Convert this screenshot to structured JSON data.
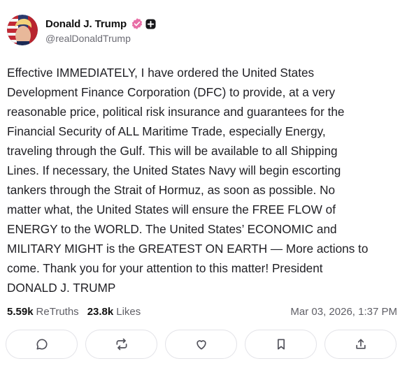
{
  "author": {
    "name": "Donald J. Trump",
    "handle": "@realDonaldTrump",
    "verified_color": "#e86ea6"
  },
  "post": {
    "text": "Effective IMMEDIATELY, I have ordered the United States\nDevelopment Finance Corporation (DFC) to provide, at a very\nreasonable price, political risk insurance and guarantees for the\nFinancial Security of ALL Maritime Trade, especially Energy,\ntraveling through the Gulf. This will be available to all Shipping\nLines. If necessary, the United States Navy will begin escorting\ntankers through the Strait of Hormuz, as soon as possible. No\nmatter what, the United States will ensure the FREE FLOW of\nENERGY to the WORLD. The United States’ ECONOMIC and\nMILITARY MIGHT is the GREATEST ON EARTH — More actions to\ncome. Thank you for your attention to this matter! President\nDONALD J. TRUMP"
  },
  "stats": {
    "retruths_count": "5.59k",
    "retruths_label": "ReTruths",
    "likes_count": "23.8k",
    "likes_label": "Likes",
    "timestamp": "Mar 03, 2026, 1:37 PM"
  },
  "actions": [
    {
      "icon": "reply-icon"
    },
    {
      "icon": "retruth-icon"
    },
    {
      "icon": "like-icon"
    },
    {
      "icon": "bookmark-icon"
    },
    {
      "icon": "share-icon"
    }
  ],
  "colors": {
    "text": "#1f1f24",
    "muted": "#5f5f66",
    "border": "#e3e3e8",
    "icon": "#52525b"
  }
}
